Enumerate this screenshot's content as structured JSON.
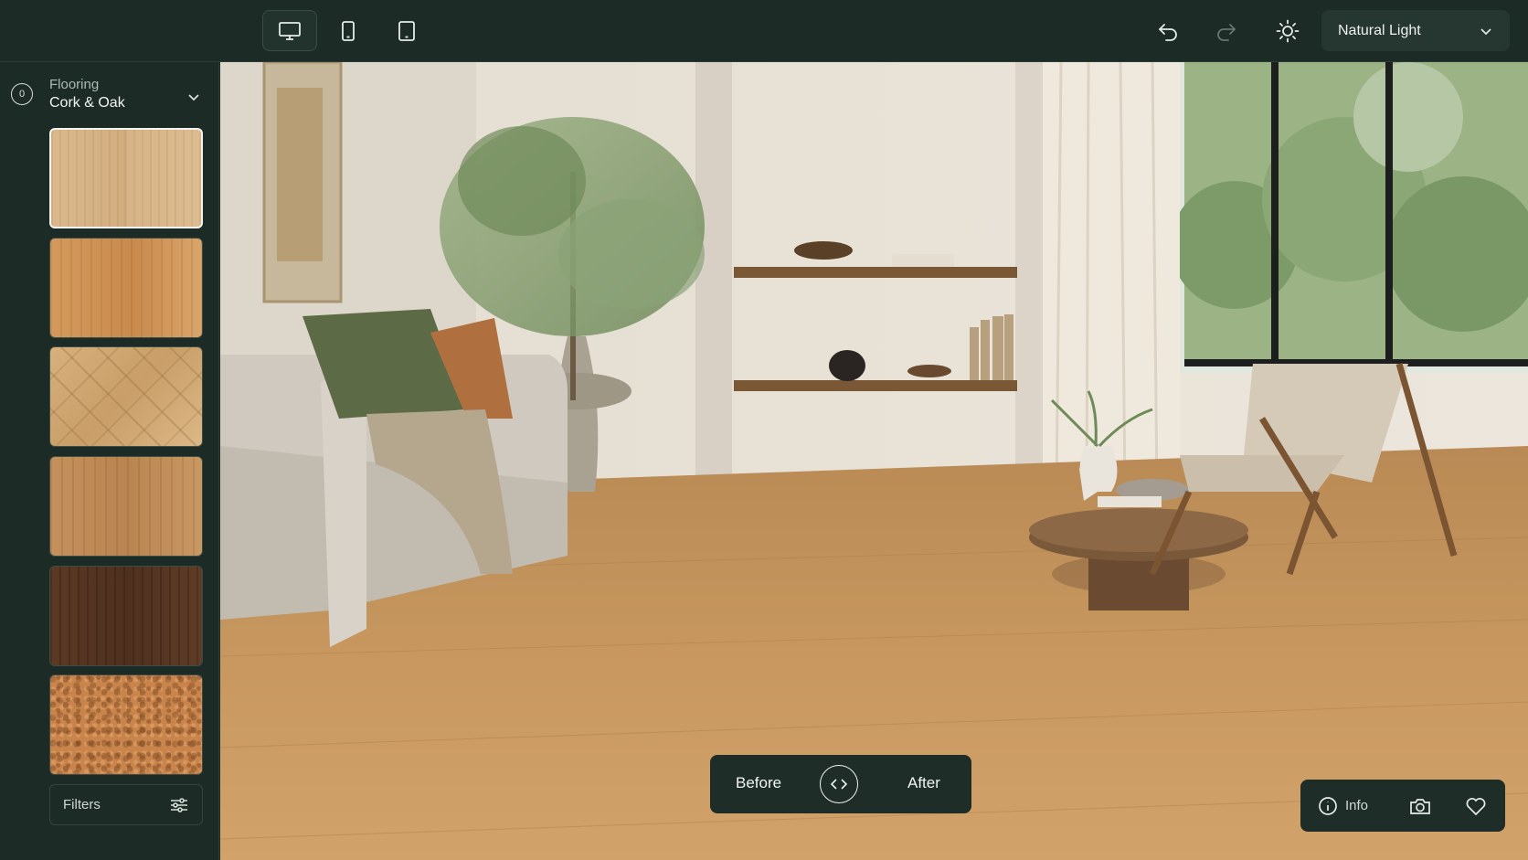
{
  "toolbar": {
    "device_views": [
      {
        "name": "desktop-icon",
        "active": true
      },
      {
        "name": "phone-icon",
        "active": false
      },
      {
        "name": "tablet-icon",
        "active": false
      }
    ],
    "undo_icon": "undo-icon",
    "redo_icon": "redo-icon",
    "lighting_icon": "sun-icon",
    "lighting_selected": "Natural Light"
  },
  "sidebar": {
    "category_label": "Flooring",
    "category_value": "Cork & Oak",
    "category_badge": "0",
    "swatches": [
      {
        "name": "light-oak",
        "color": "#d9b98d",
        "selected": true
      },
      {
        "name": "honey-oak",
        "color": "#d39a5c",
        "selected": false
      },
      {
        "name": "herringbone-oak",
        "color": "#d7b07c",
        "selected": false
      },
      {
        "name": "natural-oak",
        "color": "#c4905c",
        "selected": false
      },
      {
        "name": "dark-walnut",
        "color": "#5c3a25",
        "selected": false
      },
      {
        "name": "cork",
        "color": "#c9844c",
        "selected": false
      }
    ],
    "filters_label": "Filters"
  },
  "compare": {
    "before_label": "Before",
    "after_label": "After"
  },
  "actions": {
    "info_label": "Info",
    "camera_icon": "camera-icon",
    "favorite_icon": "heart-icon"
  },
  "colors": {
    "chrome": "#1c2b26",
    "accent_text": "#eef1ef"
  }
}
